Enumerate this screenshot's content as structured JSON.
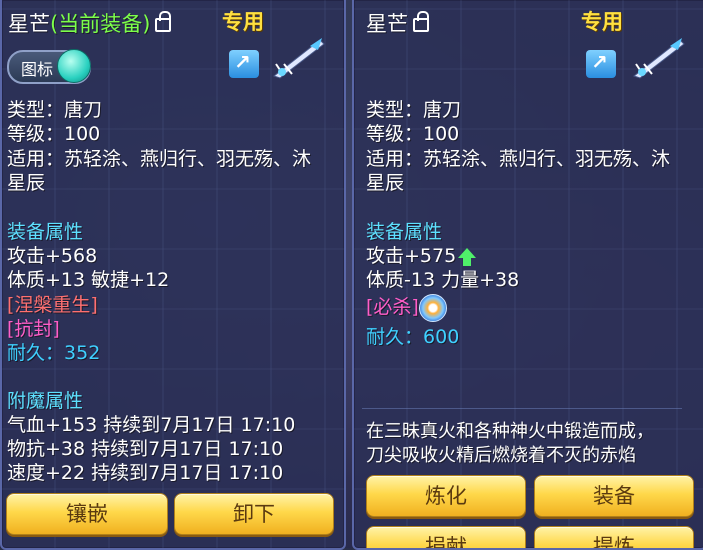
{
  "left": {
    "title": "星芒",
    "status": "(当前装备)",
    "exclusive": "专用",
    "toggle_label": "图标",
    "type": "类型：唐刀",
    "level": "等级：100",
    "fit_line1": "适用：苏轻涂、燕归行、羽无殇、沐",
    "fit_line2": "星辰",
    "attr_head": "装备属性",
    "attack": "攻击+568",
    "body_agility": "体质+13 敏捷+12",
    "special1": "[涅槃重生]",
    "special2": "[抗封]",
    "durability_label": "耐久：",
    "durability_value": "352",
    "enchant_head": "附魔属性",
    "enchant1": "气血+153 持续到7月17日 17:10",
    "enchant2": "物抗+38 持续到7月17日 17:10",
    "enchant3": "速度+22 持续到7月17日 17:10",
    "btn_inlay": "镶嵌",
    "btn_unequip": "卸下"
  },
  "right": {
    "title": "星芒",
    "exclusive": "专用",
    "type": "类型：唐刀",
    "level": "等级：100",
    "fit_line1": "适用：苏轻涂、燕归行、羽无殇、沐",
    "fit_line2": "星辰",
    "attr_head": "装备属性",
    "attack": "攻击+575",
    "body_strength": "体质-13 力量+38",
    "special1": "[必杀]",
    "durability_label": "耐久：",
    "durability_value": "600",
    "desc_line1": "在三昧真火和各种神火中锻造而成，",
    "desc_line2": "刀尖吸收火精后燃烧着不灭的赤焰",
    "btn_refine": "炼化",
    "btn_equip": "装备",
    "btn_bottom1": "捐献",
    "btn_bottom2": "提炼"
  },
  "colors": {
    "status_green": "#7cff4a",
    "exclusive_yellow": "#ffe040",
    "section_cyan": "#5ee0ff",
    "special_red": "#ff7070",
    "special_pink": "#ff5ec8",
    "durability_cyan": "#3fd0ff",
    "button_gold": "#ffd84a"
  },
  "icons": [
    "lock-icon",
    "share-icon",
    "sword-item-icon",
    "toggle-knob",
    "upgrade-arrow-icon",
    "skill-icon"
  ]
}
